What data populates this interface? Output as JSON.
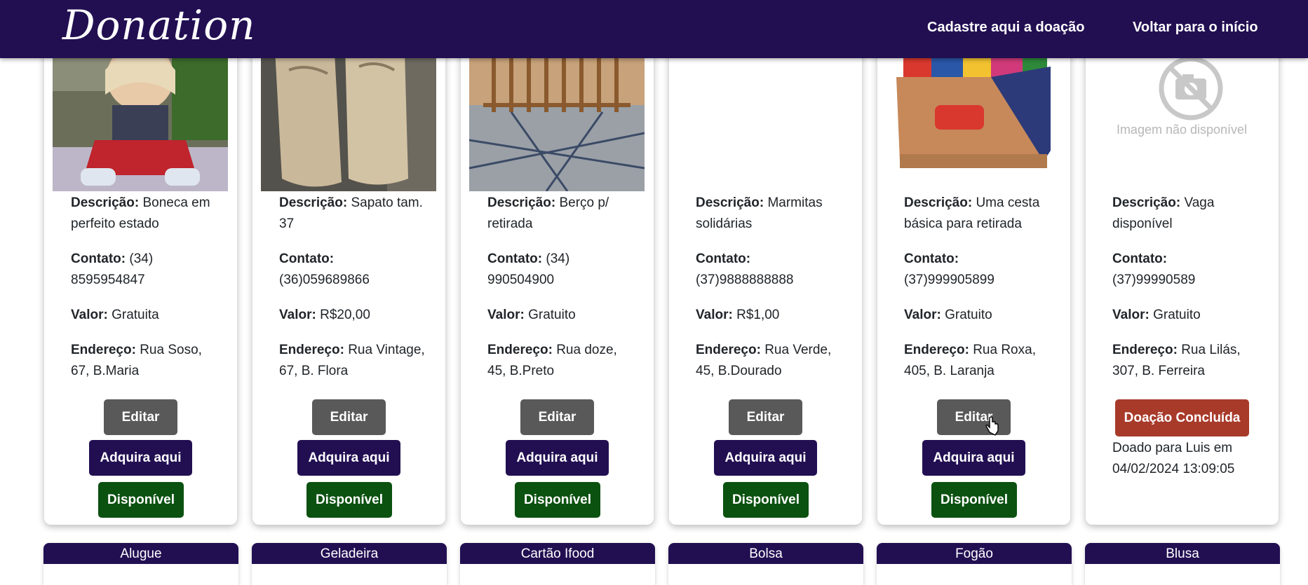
{
  "nav": {
    "brand": "Donation",
    "link_register": "Cadastre aqui a doação",
    "link_home": "Voltar para o início"
  },
  "labels": {
    "descricao": "Descrição:",
    "contato": "Contato:",
    "valor": "Valor:",
    "endereco": "Endereço:",
    "edit": "Editar",
    "buy": "Adquira aqui",
    "available": "Disponível",
    "concluded": "Doação Concluída",
    "image_unavailable": "Imagem não disponível"
  },
  "cards": [
    {
      "image": "boneca-photo",
      "descricao": "Boneca em perfeito estado",
      "contato": "(34) 8595954847",
      "valor": "Gratuita",
      "endereco": "Rua Soso, 67, B.Maria"
    },
    {
      "image": "sapato-photo",
      "descricao": "Sapato tam. 37",
      "contato": "(36)059689866",
      "valor": "R$20,00",
      "endereco": "Rua Vintage, 67, B. Flora"
    },
    {
      "image": "berco-photo",
      "descricao": "Berço p/ retirada",
      "contato": "(34) 990504900",
      "valor": "Gratuito",
      "endereco": "Rua doze, 45, B.Preto"
    },
    {
      "image": "none",
      "descricao": "Marmitas solidárias",
      "contato": "(37)9888888888",
      "valor": "R$1,00",
      "endereco": "Rua Verde, 45, B.Dourado"
    },
    {
      "image": "cesta-basica-photo",
      "descricao": "Uma cesta básica para retirada",
      "contato": "(37)999905899",
      "valor": "Gratuito",
      "endereco": "Rua Roxa, 405, B. Laranja"
    },
    {
      "image": "image-unavailable-placeholder",
      "descricao": "Vaga disponível",
      "contato": "(37)99990589",
      "valor": "Gratuito",
      "endereco": "Rua Lilás, 307, B. Ferreira",
      "status_note": "Doado para Luis em 04/02/2024 13:09:05"
    }
  ],
  "bottom_titles": [
    "Alugue",
    "Geladeira",
    "Cartão Ifood",
    "Bolsa",
    "Fogão",
    "Blusa"
  ],
  "colors": {
    "navbar": "#220f52",
    "edit_button": "#595959",
    "buy_button": "#220f52",
    "available_button": "#0b5110",
    "concluded_button": "#a83a2a"
  }
}
